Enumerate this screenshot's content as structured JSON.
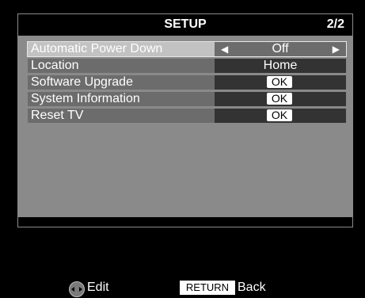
{
  "header": {
    "title": "SETUP",
    "page": "2/2"
  },
  "menu": {
    "items": [
      {
        "label": "Automatic Power Down",
        "value": "Off"
      },
      {
        "label": "Location",
        "value": "Home"
      },
      {
        "label": "Software Upgrade",
        "button": "OK"
      },
      {
        "label": "System Information",
        "button": "OK"
      },
      {
        "label": "Reset TV",
        "button": "OK"
      }
    ]
  },
  "footer": {
    "edit_label": "Edit",
    "return_key": "RETURN",
    "back_label": "Back"
  },
  "icons": [
    "dpad-left-right-icon",
    "arrow-left-icon",
    "arrow-right-icon"
  ],
  "colors": {
    "background": "#000000",
    "panel": "#8a8a8a",
    "selected": "#c2c2c2"
  }
}
